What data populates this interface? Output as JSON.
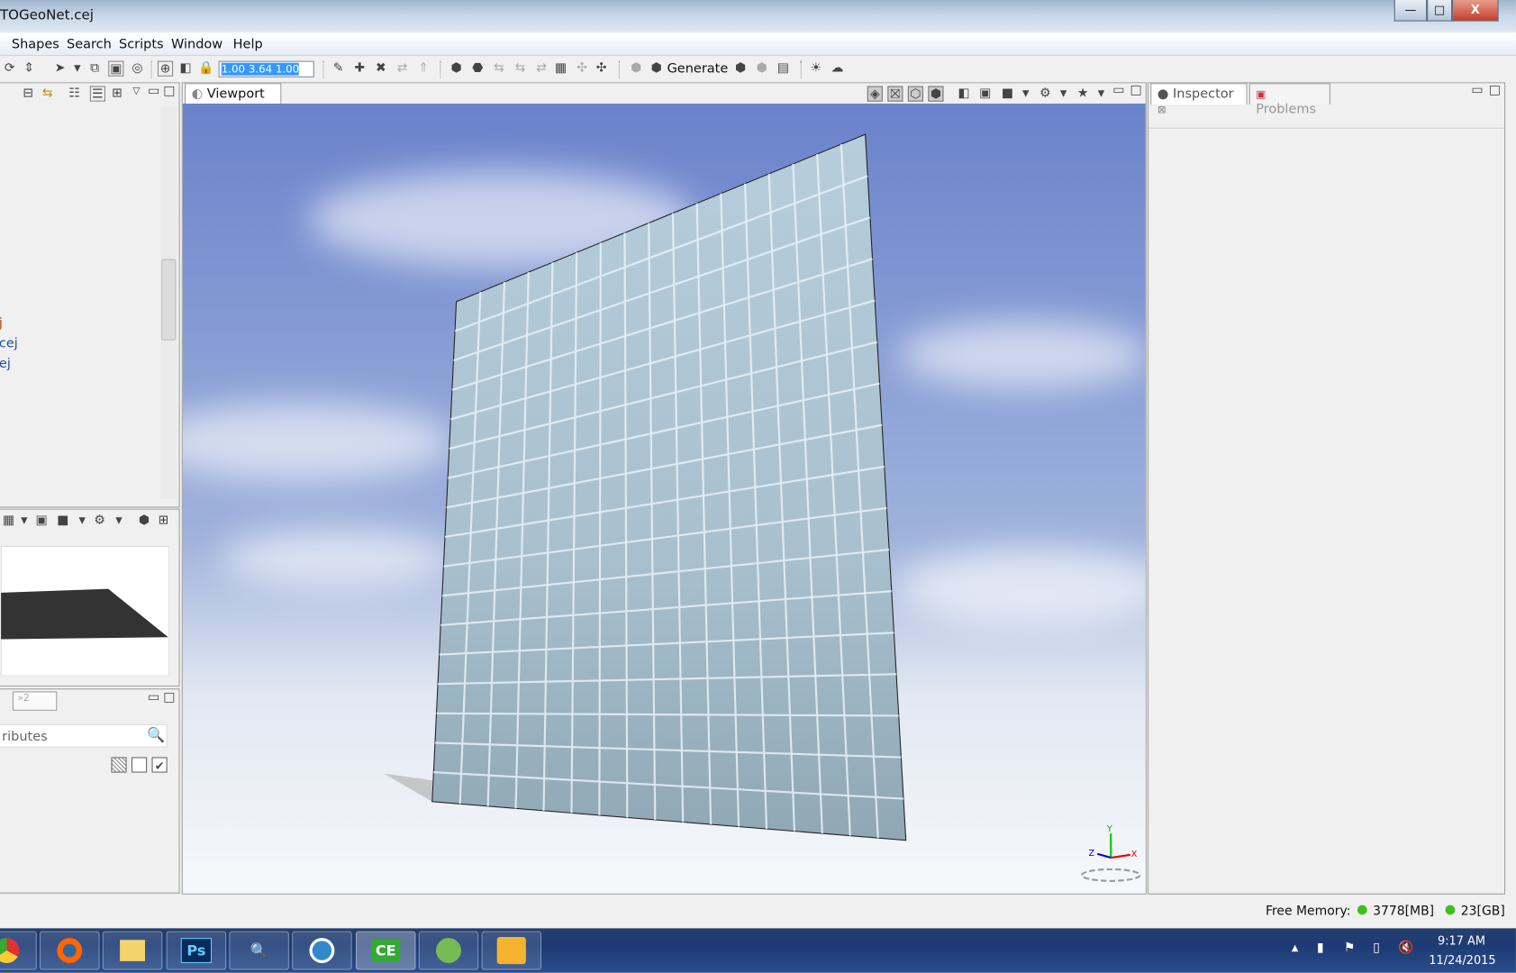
{
  "window": {
    "title": "TOGeoNet.cej",
    "min": "—",
    "max": "□",
    "close": "X"
  },
  "menu": [
    "Shapes",
    "Search",
    "Scripts",
    "Window",
    "Help"
  ],
  "toolbar": {
    "coord_value": "1.00 3.64 1.00",
    "generate_label": "Generate"
  },
  "left_tree": {
    "items": [
      "j",
      "cej",
      "ej"
    ]
  },
  "left_bottom": {
    "tab_overflow": "»2",
    "search_placeholder": "ributes"
  },
  "viewport": {
    "tab_label": "Viewport",
    "axis": {
      "x": "X",
      "y": "Y",
      "z": "Z"
    }
  },
  "right": {
    "tabs": [
      {
        "label": "Inspector"
      },
      {
        "label": "Problems"
      }
    ]
  },
  "status": {
    "free_memory_label": "Free Memory:",
    "memory_mb": "3778[MB]",
    "memory_gb": "23[GB]",
    "indicator_color": "#3fbf1f"
  },
  "taskbar": {
    "apps": [
      "Chrome",
      "Firefox",
      "Explorer",
      "Ps",
      "Search",
      "Browser",
      "CE",
      "Android",
      "Outlook"
    ],
    "time": "9:17 AM",
    "date": "11/24/2015"
  },
  "colors": {
    "sky_top": "#6b84cc",
    "sky_bottom": "#eef2f8",
    "glass": "#a9c2d0",
    "selection": "#3399ff"
  }
}
